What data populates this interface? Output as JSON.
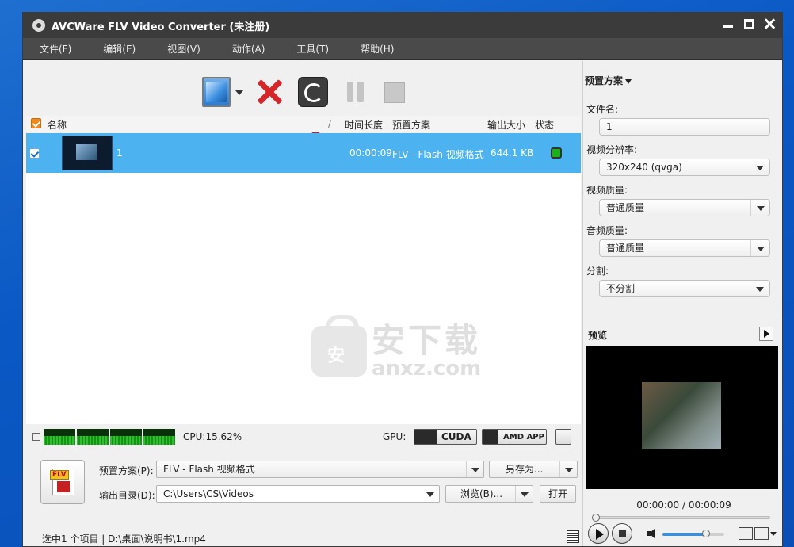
{
  "window": {
    "title": "AVCWare FLV Video Converter (未注册)"
  },
  "menu": [
    "文件(F)",
    "编辑(E)",
    "视图(V)",
    "动作(A)",
    "工具(T)",
    "帮助(H)"
  ],
  "list": {
    "headers": {
      "name": "名称",
      "sort": "/",
      "duration": "时间长度",
      "profile": "预置方案",
      "size": "输出大小",
      "status": "状态"
    },
    "rows": [
      {
        "name": "1",
        "duration": "00:00:09",
        "profile": "FLV - Flash 视频格式",
        "size": "644.1 KB",
        "status_color": "#1ab21a",
        "checked": true
      }
    ]
  },
  "watermark": {
    "line1": "安下载",
    "line2": "anxz.com",
    "bag_glyph": "安"
  },
  "perf": {
    "cpu_text": "CPU:15.62%",
    "gpu_label": "GPU:",
    "cuda_label": "CUDA",
    "amd_label": "AMD APP"
  },
  "bottom": {
    "flv_tag": "FLV",
    "profile_label": "预置方案(P):",
    "profile_value": "FLV - Flash 视频格式",
    "save_as_label": "另存为...",
    "output_label": "输出目录(D):",
    "output_value": "C:\\Users\\CS\\Videos",
    "browse_label": "浏览(B)...",
    "open_label": "打开"
  },
  "statusbar": {
    "text": "选中1 个项目 | D:\\桌面\\说明书\\1.mp4"
  },
  "right_panel": {
    "profile_header": "预置方案",
    "filename_label": "文件名:",
    "filename_value": "1",
    "resolution_label": "视频分辨率:",
    "resolution_value": "320x240 (qvga)",
    "video_quality_label": "视频质量:",
    "video_quality_value": "普通质量",
    "audio_quality_label": "音频质量:",
    "audio_quality_value": "普通质量",
    "split_label": "分割:",
    "split_value": "不分割"
  },
  "preview": {
    "title": "预览",
    "time": "00:00:00 / 00:00:09",
    "seek_fraction": 0.0,
    "volume_fraction": 0.7
  },
  "colors": {
    "selection": "#4cb3f0",
    "titlebar": "#3b3b3b",
    "menubar": "#4a4a4a",
    "accent_orange": "#f08a1e"
  }
}
